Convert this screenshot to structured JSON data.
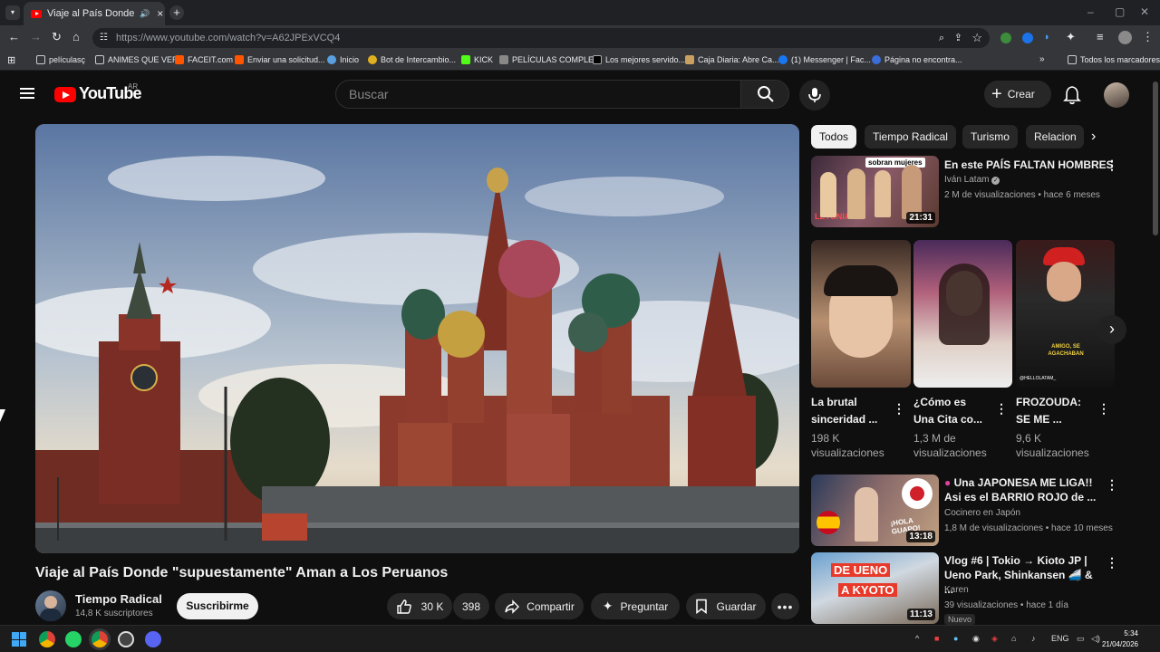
{
  "browser": {
    "tab_title": "Viaje al País Donde \"supue",
    "url": "https://www.youtube.com/watch?v=A62JPExVCQ4",
    "url_host": "www.youtube.com",
    "bookmarks": [
      "películasç",
      "ANIMES QUE VER",
      "FACEIT.com",
      "Enviar una solicitud...",
      "Inicio",
      "Bot de Intercambio...",
      "KICK",
      "PELÍCULAS COMPLE...",
      "Los mejores servido...",
      "Caja Diaria: Abre Ca...",
      "(1) Messenger | Fac...",
      "Página no encontra..."
    ],
    "all_bookmarks": "Todos los marcadores"
  },
  "header": {
    "logo": "YouTube",
    "region": "AR",
    "search_placeholder": "Buscar",
    "create": "Crear"
  },
  "video": {
    "title": "Viaje al País Donde \"supuestamente\" Aman a Los Peruanos",
    "channel": "Tiempo Radical",
    "subscribers": "14,8 K suscriptores",
    "subscribe": "Suscribirme",
    "likes": "30 K",
    "comments": "398",
    "share": "Compartir",
    "ask": "Preguntar",
    "save": "Guardar"
  },
  "sidebar": {
    "chips": [
      "Todos",
      "Tiempo Radical",
      "Turismo",
      "Relacion"
    ],
    "items": [
      {
        "title": "En este PAÍS FALTAN HOMBRES",
        "title2": "",
        "channel": "Iván Latam",
        "meta": "2 M de visualizaciones • hace 6 meses",
        "duration": "21:31",
        "thumb_text": "sobran mujeres",
        "thumb_text2": "LETONIA"
      },
      {
        "title": "Una JAPONESA ME LIGA!!",
        "title2": "Asi es el BARRIO ROJO de ...",
        "channel": "Cocinero en Japón",
        "meta": "1,8 M de visualizaciones • hace 10 meses",
        "duration": "13:18",
        "thumb_text": "¡HOLA GUAPO!"
      },
      {
        "title": "Vlog #6 | Tokio → Kioto JP |",
        "title2": "Ueno Park, Shinkansen 🚄 & ...",
        "channel": "Karen",
        "meta": "39 visualizaciones • hace 1 día",
        "duration": "11:13",
        "badge": "Nuevo",
        "thumb_text": "DE UENO",
        "thumb_text2": "A KYOTO"
      }
    ],
    "shorts": [
      {
        "title1": "La brutal",
        "title2": "sinceridad ...",
        "views1": "198 K",
        "views2": "visualizaciones"
      },
      {
        "title1": "¿Cómo es",
        "title2": "Una Cita co...",
        "views1": "1,3 M de",
        "views2": "visualizaciones"
      },
      {
        "title1": "FROZOUDA:",
        "title2": "SE ME ...",
        "views1": "9,6 K",
        "views2": "visualizaciones",
        "thumb_text": "AMIGO, SE AGACHABAN",
        "thumb_text2": "@HELLOLATAM_"
      }
    ]
  },
  "taskbar": {
    "lang": "ENG",
    "time": "5:34",
    "date": "21/04/2026"
  }
}
